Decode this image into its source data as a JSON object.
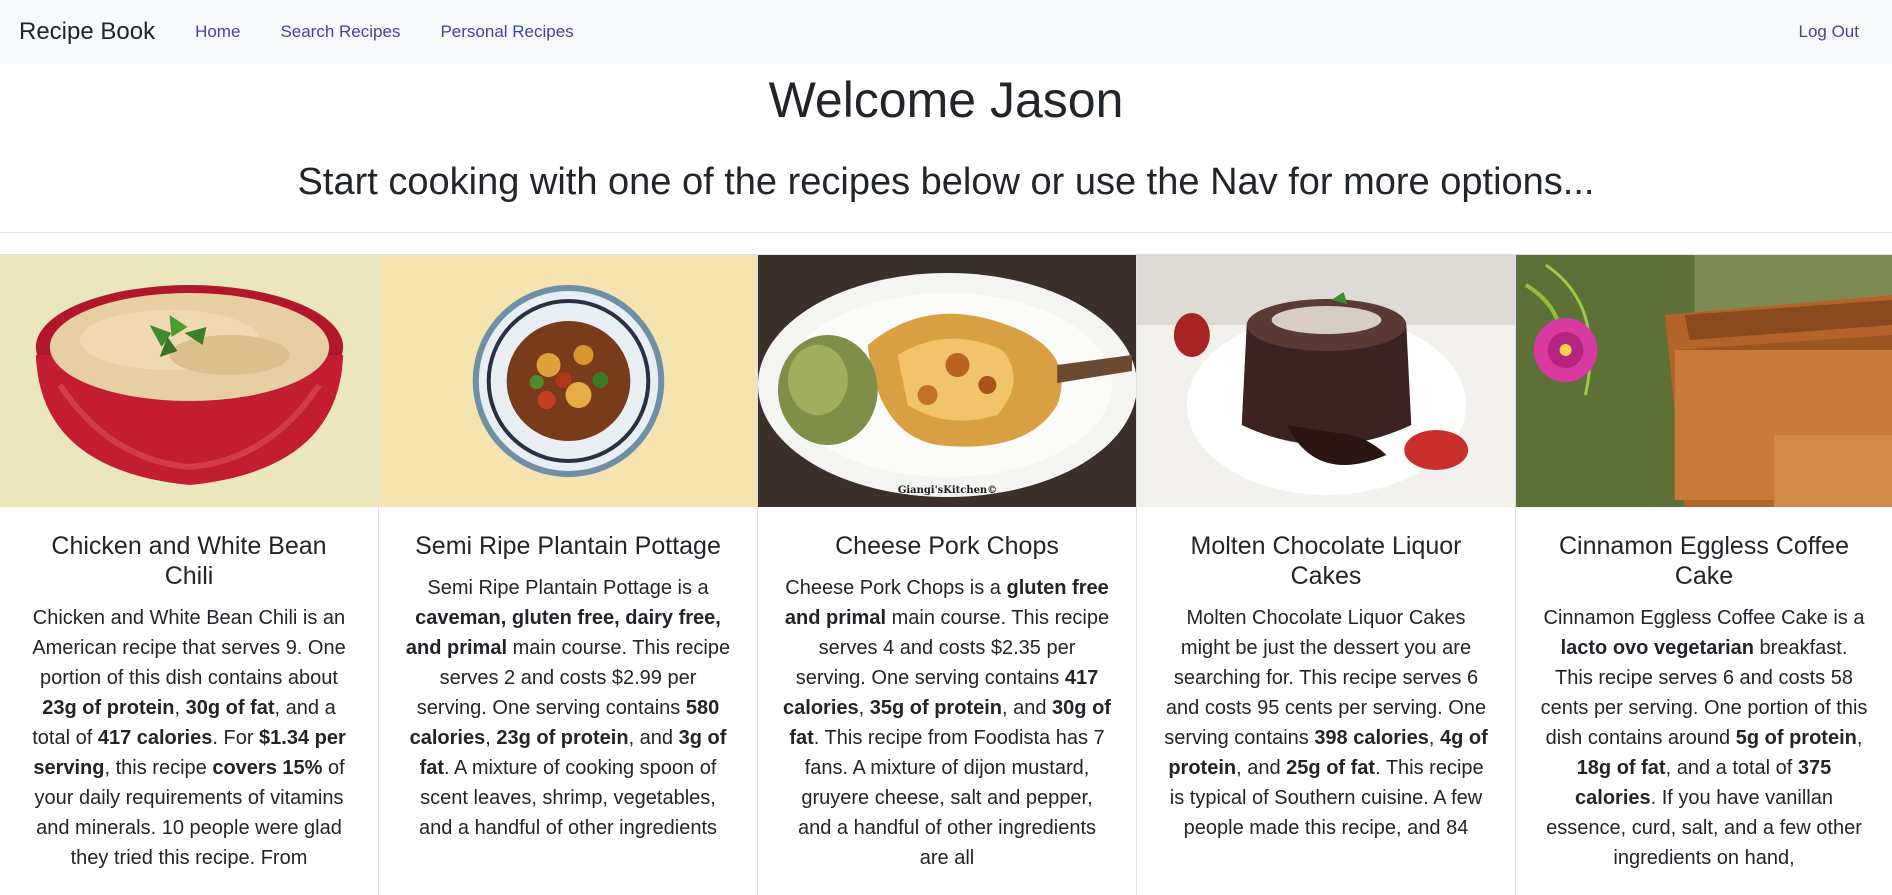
{
  "nav": {
    "brand": "Recipe Book",
    "links": [
      "Home",
      "Search Recipes",
      "Personal Recipes"
    ],
    "logout": "Log Out"
  },
  "header": {
    "welcome": "Welcome Jason",
    "subtitle": "Start cooking with one of the recipes below or use the Nav for more options..."
  },
  "recipes": [
    {
      "title": "Chicken and White Bean Chili",
      "image_icon": "chili-bowl-photo",
      "summary": [
        {
          "t": "Chicken and White Bean Chili is an American recipe that serves 9. One portion of this dish contains about ",
          "b": false
        },
        {
          "t": "23g of protein",
          "b": true
        },
        {
          "t": ", ",
          "b": false
        },
        {
          "t": "30g of fat",
          "b": true
        },
        {
          "t": ", and a total of ",
          "b": false
        },
        {
          "t": "417 calories",
          "b": true
        },
        {
          "t": ". For ",
          "b": false
        },
        {
          "t": "$1.34 per serving",
          "b": true
        },
        {
          "t": ", this recipe ",
          "b": false
        },
        {
          "t": "covers 15%",
          "b": true
        },
        {
          "t": " of your daily requirements of vitamins and minerals. 10 people were glad they tried this recipe. From",
          "b": false
        }
      ]
    },
    {
      "title": "Semi Ripe Plantain Pottage",
      "image_icon": "plantain-pottage-photo",
      "summary": [
        {
          "t": "Semi Ripe Plantain Pottage is a ",
          "b": false
        },
        {
          "t": "caveman, gluten free, dairy free, and primal",
          "b": true
        },
        {
          "t": " main course. This recipe serves 2 and costs $2.99 per serving. One serving contains ",
          "b": false
        },
        {
          "t": "580 calories",
          "b": true
        },
        {
          "t": ", ",
          "b": false
        },
        {
          "t": "23g of protein",
          "b": true
        },
        {
          "t": ", and ",
          "b": false
        },
        {
          "t": "3g of fat",
          "b": true
        },
        {
          "t": ". A mixture of cooking spoon of scent leaves, shrimp, vegetables, and a handful of other ingredients",
          "b": false
        }
      ]
    },
    {
      "title": "Cheese Pork Chops",
      "image_icon": "pork-chop-photo",
      "image_caption": "Giangi'sKitchen©",
      "summary": [
        {
          "t": "Cheese Pork Chops is a ",
          "b": false
        },
        {
          "t": "gluten free and primal",
          "b": true
        },
        {
          "t": " main course. This recipe serves 4 and costs $2.35 per serving. One serving contains ",
          "b": false
        },
        {
          "t": "417 calories",
          "b": true
        },
        {
          "t": ", ",
          "b": false
        },
        {
          "t": "35g of protein",
          "b": true
        },
        {
          "t": ", and ",
          "b": false
        },
        {
          "t": "30g of fat",
          "b": true
        },
        {
          "t": ". This recipe from Foodista has 7 fans. A mixture of dijon mustard, gruyere cheese, salt and pepper, and a handful of other ingredients are all",
          "b": false
        }
      ]
    },
    {
      "title": "Molten Chocolate Liquor Cakes",
      "image_icon": "lava-cake-photo",
      "summary": [
        {
          "t": "Molten Chocolate Liquor Cakes might be just the dessert you are searching for. This recipe serves 6 and costs 95 cents per serving. One serving contains ",
          "b": false
        },
        {
          "t": "398 calories",
          "b": true
        },
        {
          "t": ", ",
          "b": false
        },
        {
          "t": "4g of protein",
          "b": true
        },
        {
          "t": ", and ",
          "b": false
        },
        {
          "t": "25g of fat",
          "b": true
        },
        {
          "t": ". This recipe is typical of Southern cuisine. A few people made this recipe, and 84",
          "b": false
        }
      ]
    },
    {
      "title": "Cinnamon Eggless Coffee Cake",
      "image_icon": "coffee-cake-photo",
      "summary": [
        {
          "t": "Cinnamon Eggless Coffee Cake is a ",
          "b": false
        },
        {
          "t": "lacto ovo vegetarian",
          "b": true
        },
        {
          "t": " breakfast. This recipe serves 6 and costs 58 cents per serving. One portion of this dish contains around ",
          "b": false
        },
        {
          "t": "5g of protein",
          "b": true
        },
        {
          "t": ", ",
          "b": false
        },
        {
          "t": "18g of fat",
          "b": true
        },
        {
          "t": ", and a total of ",
          "b": false
        },
        {
          "t": "375 calories",
          "b": true
        },
        {
          "t": ". If you have vanillan essence, curd, salt, and a few other ingredients on hand,",
          "b": false
        }
      ]
    }
  ]
}
